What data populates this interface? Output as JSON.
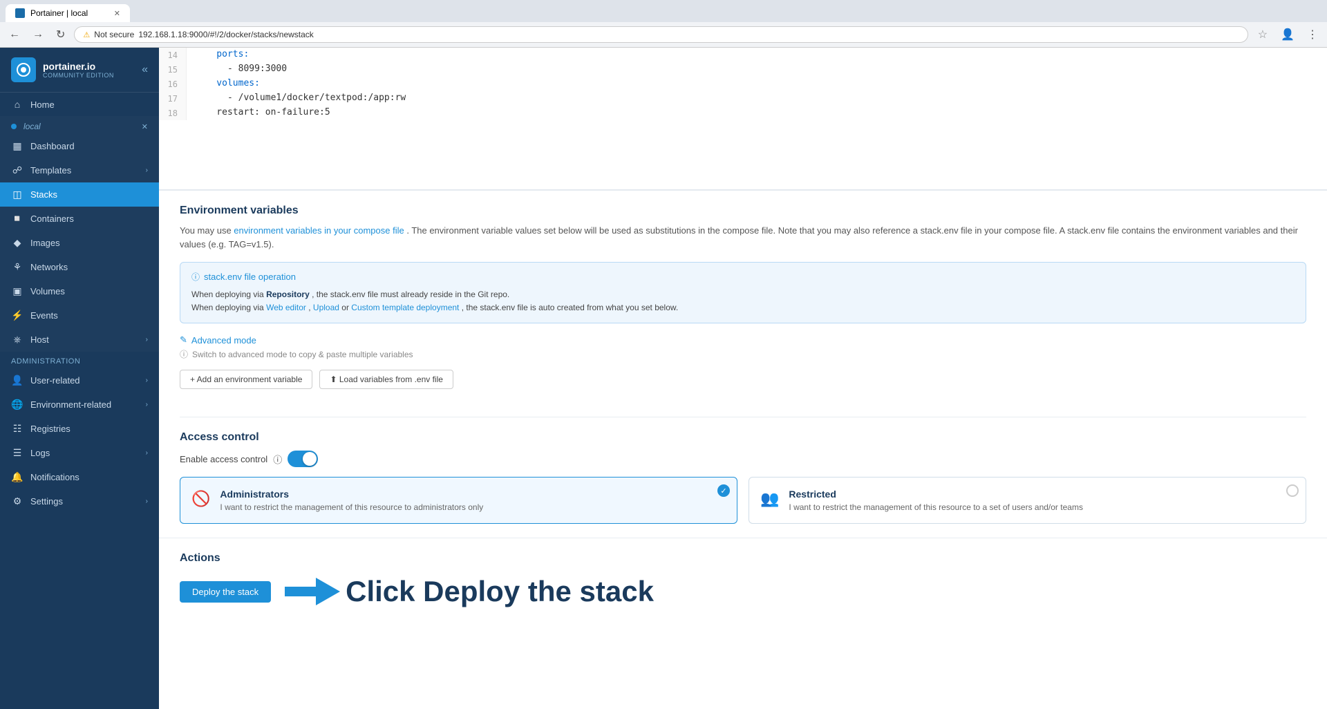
{
  "browser": {
    "tab_title": "Portainer | local",
    "address": "192.168.1.18:9000/#!/2/docker/stacks/newstack",
    "security_label": "Not secure"
  },
  "sidebar": {
    "logo_text": "portainer.io",
    "logo_sub": "COMMUNITY EDITION",
    "home_label": "Home",
    "env_name": "local",
    "dashboard_label": "Dashboard",
    "templates_label": "Templates",
    "stacks_label": "Stacks",
    "containers_label": "Containers",
    "images_label": "Images",
    "networks_label": "Networks",
    "volumes_label": "Volumes",
    "events_label": "Events",
    "host_label": "Host",
    "admin_section": "Administration",
    "user_related_label": "User-related",
    "env_related_label": "Environment-related",
    "registries_label": "Registries",
    "logs_label": "Logs",
    "notifications_label": "Notifications",
    "settings_label": "Settings"
  },
  "code_editor": {
    "lines": [
      {
        "num": "14",
        "content": "    ports:"
      },
      {
        "num": "15",
        "content": "      - 8099:3000"
      },
      {
        "num": "16",
        "content": "    volumes:"
      },
      {
        "num": "17",
        "content": "      - /volume1/docker/textpod:/app:rw"
      },
      {
        "num": "18",
        "content": "    restart: on-failure:5"
      }
    ]
  },
  "env_variables": {
    "section_title": "Environment variables",
    "desc_text": "You may use ",
    "desc_link": "environment variables in your compose file",
    "desc_rest": ". The environment variable values set below will be used as substitutions in the compose file. Note that you may also reference a stack.env file in your compose file. A stack.env file contains the environment variables and their values (e.g. TAG=v1.5).",
    "info_title": "stack.env file operation",
    "info_line1_pre": "When deploying via ",
    "info_line1_bold": "Repository",
    "info_line1_post": ", the stack.env file must already reside in the Git repo.",
    "info_line2_pre": "When deploying via ",
    "info_line2_bold1": "Web editor",
    "info_line2_mid": ", ",
    "info_line2_bold2": "Upload",
    "info_line2_mid2": " or ",
    "info_line2_bold3": "Custom template deployment",
    "info_line2_post": ", the stack.env file is auto created from what you set below.",
    "advanced_mode_label": "Advanced mode",
    "switch_hint": "Switch to advanced mode to copy & paste multiple variables",
    "add_env_label": "+ Add an environment variable",
    "load_env_label": "⬆ Load variables from .env file"
  },
  "access_control": {
    "section_title": "Access control",
    "enable_label": "Enable access control",
    "info_icon": "ℹ",
    "administrators": {
      "title": "Administrators",
      "description": "I want to restrict the management of this resource to administrators only",
      "selected": true
    },
    "restricted": {
      "title": "Restricted",
      "description": "I want to restrict the management of this resource to a set of users and/or teams",
      "selected": false
    }
  },
  "actions": {
    "section_title": "Actions",
    "deploy_label": "Deploy the stack",
    "click_deploy_text": "Click Deploy the stack"
  }
}
